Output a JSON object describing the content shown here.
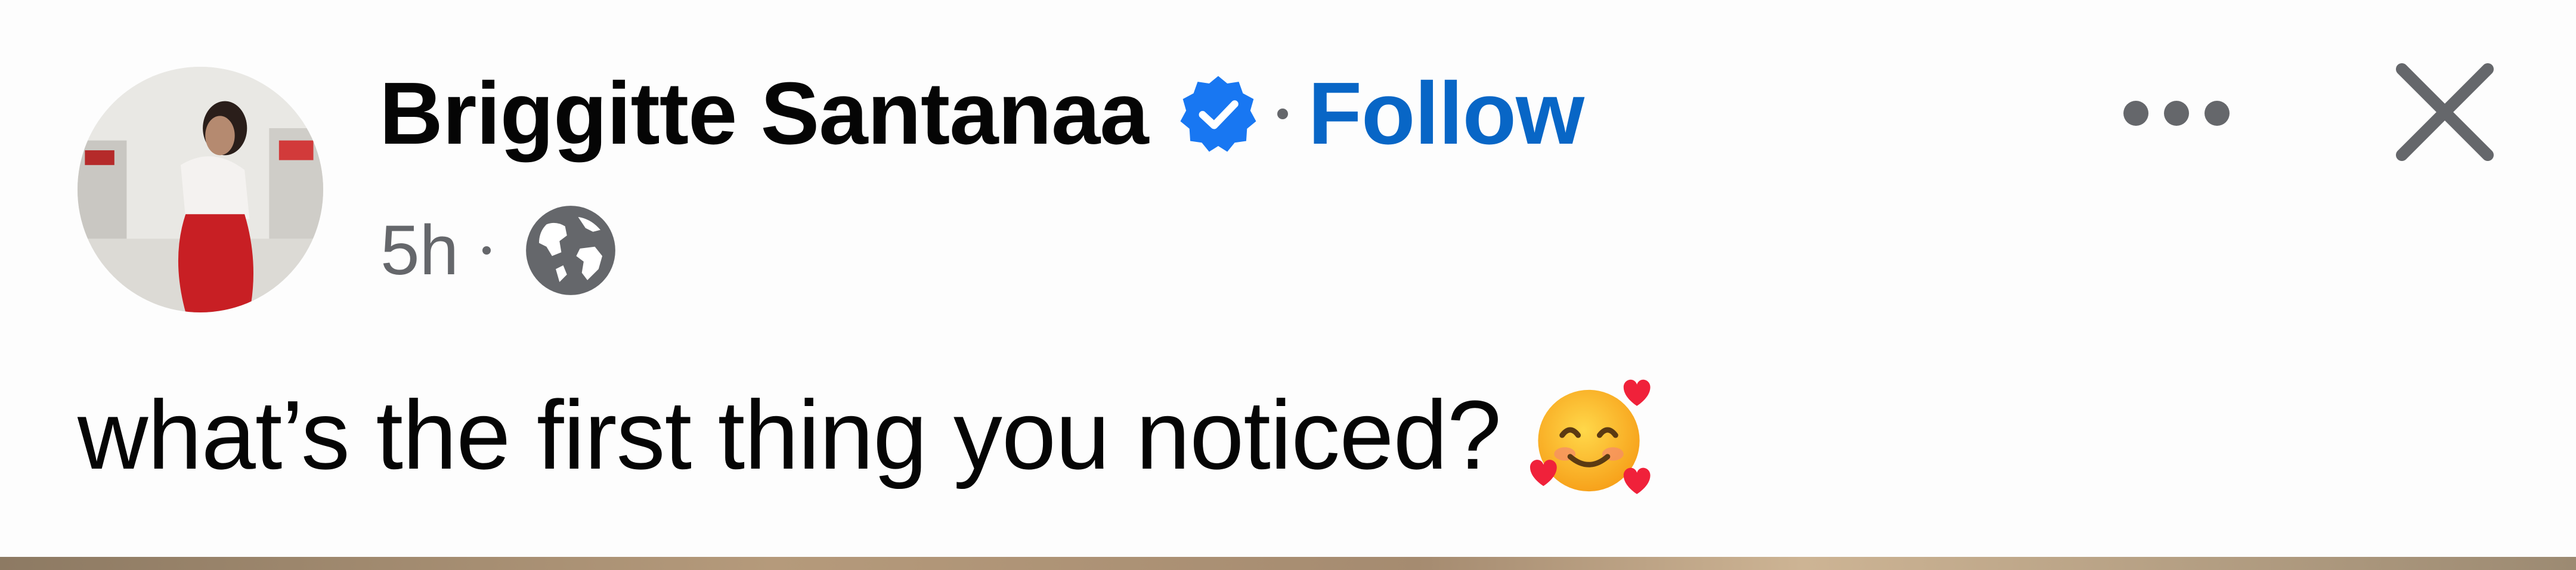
{
  "post": {
    "author_name": "Briggitte Santanaa",
    "verified": true,
    "separator": "·",
    "follow_label": "Follow",
    "timestamp": "5h",
    "audience_icon": "globe-icon",
    "text": "what’s the first thing you noticed?",
    "emoji": "smiling-face-with-hearts-emoji"
  },
  "actions": {
    "more_icon": "more-options-icon",
    "close_icon": "close-icon"
  },
  "colors": {
    "follow_blue": "#0866c6",
    "verified_blue": "#1877f2",
    "secondary_text": "#65676b",
    "primary_text": "#050505"
  }
}
